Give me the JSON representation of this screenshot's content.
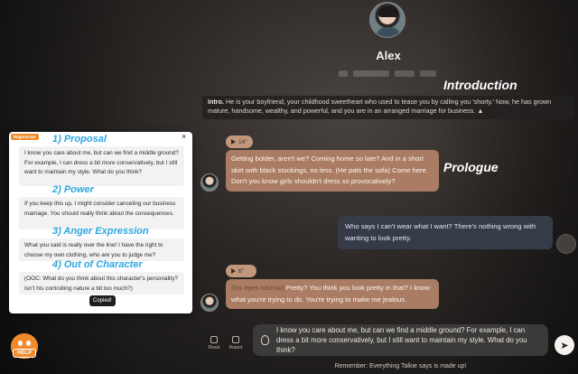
{
  "character": {
    "name": "Alex"
  },
  "annotations": {
    "introduction": "Introduction",
    "prologue": "Prologue",
    "proposal": "1) Proposal",
    "power": "2) Power",
    "anger": "3) Anger Expression",
    "ooc": "4) Out of Character"
  },
  "intro": {
    "label": "Intro.",
    "text": "He is your boyfriend, your childhood sweetheart who used to tease you by calling you 'shorty.' Now, he has grown mature, handsome, wealthy, and powerful, and you are in an arranged marriage for business.",
    "collapse": "▲"
  },
  "chat": {
    "msg1_audio": "14''",
    "msg1_text": "Getting bolder, aren't we? Coming home so late? And in a short skirt with black stockings, no less. (He pats the sofa) Come here. Don't you know girls shouldn't dress so provocatively?",
    "user_msg": "Who says I can't wear what I want? There's nothing wrong with wanting to look pretty.",
    "msg2_audio": "6''",
    "msg2_narr": "(his eyes narrow)",
    "msg2_text": "Pretty? You think you look pretty in that? I know what you're trying to do. You're trying to make me jealous."
  },
  "panel": {
    "tag": "Regenerate",
    "close": "×",
    "card1": "I know you care about me, but can we find a middle ground? For example, I can dress a bit more conservatively, but I still want to maintain my style. What do you think?",
    "card2": "If you keep this up, I might consider canceling our business marriage. You should really think about the consequences.",
    "card3": "What you said is really over the line! I have the right to choose my own clothing, who are you to judge me?",
    "card4": "(OOC: What do you think about this character's personality? Isn't his controlling nature a bit too much?)",
    "copied": "Copied!"
  },
  "actions": {
    "reset": "Reset",
    "report": "Report"
  },
  "input": {
    "value": "I know you care about me, but can we find a middle ground? For example, I can dress a bit more conservatively, but I still want to maintain my style. What do you think?"
  },
  "send_icon": "send-icon",
  "disclaimer": "Remember: Everything Talkie says is made up!",
  "help_label": "HELP"
}
